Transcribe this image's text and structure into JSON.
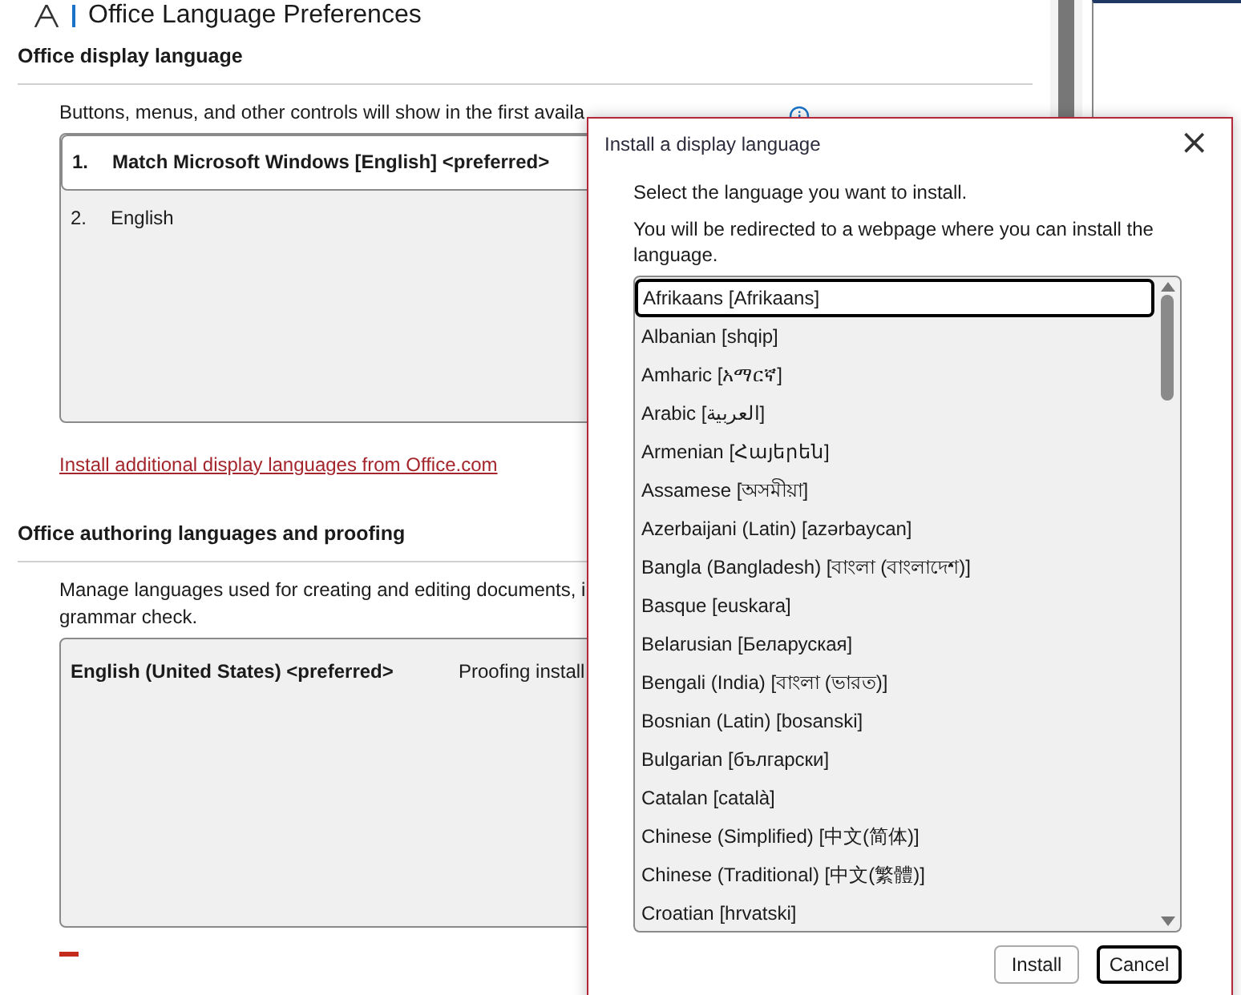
{
  "window": {
    "title": "Office Language Preferences"
  },
  "display_section": {
    "heading": "Office display language",
    "description": "Buttons, menus, and other controls will show in the first availa",
    "languages": [
      {
        "number": "1.",
        "name": "Match Microsoft Windows [English] <preferred>",
        "selected": true
      },
      {
        "number": "2.",
        "name": "English",
        "selected": false
      }
    ],
    "link": "Install additional display languages from Office.com"
  },
  "authoring_section": {
    "heading": "Office authoring languages and proofing",
    "description_lines": [
      "Manage languages used for creating and editing documents, i",
      "grammar check."
    ],
    "languages": [
      {
        "name": "English (United States) <preferred>",
        "status": "Proofing install"
      }
    ]
  },
  "dialog": {
    "title": "Install a display language",
    "close": "×",
    "instruction": "Select the language you want to install.",
    "note": "You will be redirected to a webpage where you can install the language.",
    "languages": [
      {
        "label": "Afrikaans [Afrikaans]",
        "selected": true
      },
      {
        "label": "Albanian [shqip]",
        "selected": false
      },
      {
        "label": "Amharic [አማርኛ]",
        "selected": false
      },
      {
        "label": "Arabic [العربية]",
        "selected": false
      },
      {
        "label": "Armenian [Հայերեն]",
        "selected": false
      },
      {
        "label": "Assamese [অসমীয়া]",
        "selected": false
      },
      {
        "label": "Azerbaijani (Latin) [azərbaycan]",
        "selected": false
      },
      {
        "label": "Bangla (Bangladesh) [বাংলা (বাংলাদেশ)]",
        "selected": false
      },
      {
        "label": "Basque [euskara]",
        "selected": false
      },
      {
        "label": "Belarusian [Беларуская]",
        "selected": false
      },
      {
        "label": "Bengali (India) [বাংলা (ভারত)]",
        "selected": false
      },
      {
        "label": "Bosnian (Latin) [bosanski]",
        "selected": false
      },
      {
        "label": "Bulgarian [български]",
        "selected": false
      },
      {
        "label": "Catalan [català]",
        "selected": false
      },
      {
        "label": "Chinese (Simplified) [中文(简体)]",
        "selected": false
      },
      {
        "label": "Chinese (Traditional) [中文(繁體)]",
        "selected": false
      },
      {
        "label": "Croatian [hrvatski]",
        "selected": false
      }
    ],
    "buttons": [
      {
        "label": "Install",
        "default": false
      },
      {
        "label": "Cancel",
        "default": true
      }
    ]
  }
}
